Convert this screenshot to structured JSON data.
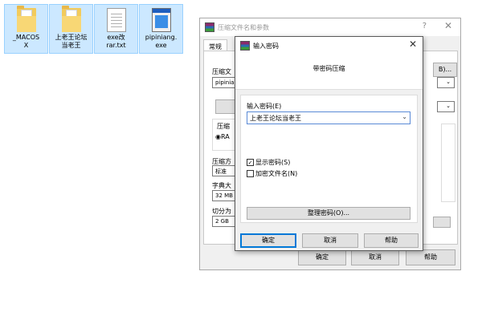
{
  "desktop": {
    "icons": [
      {
        "label": "_MACOS\nX",
        "type": "folder-icon"
      },
      {
        "label": "上老王论坛\n当老王",
        "type": "folder-icon"
      },
      {
        "label": "exe改\nrar.txt",
        "type": "text-file-icon"
      },
      {
        "label": "pipiniang.\nexe",
        "type": "exe-file-icon"
      }
    ]
  },
  "archive_window": {
    "title": "压缩文件名和参数",
    "help_glyph": "?",
    "close_glyph": "✕",
    "tab_general": "常规",
    "label_archive": "压缩文",
    "archive_name_value": "pipiniar",
    "browse_label": "B)...",
    "label_profile": "压缩",
    "radio_format": "RA",
    "label_method": "压缩方",
    "method_value": "标准",
    "label_dict": "字典大",
    "dict_value": "32 MB",
    "label_split": "切分为",
    "split_value": "2 GB",
    "ok_label": "确定",
    "cancel_label": "取消",
    "help_label": "帮助"
  },
  "password_dialog": {
    "title": "输入密码",
    "close_glyph": "✕",
    "subtitle": "带密码压缩",
    "password_label": "输入密码(E)",
    "password_value": "上老王论坛当老王",
    "show_password_label": "显示密码(S)",
    "show_password_checked": true,
    "encrypt_names_label": "加密文件名(N)",
    "encrypt_names_checked": false,
    "organize_label": "整理密码(O)...",
    "ok_label": "确定",
    "cancel_label": "取消",
    "help_label": "帮助"
  }
}
